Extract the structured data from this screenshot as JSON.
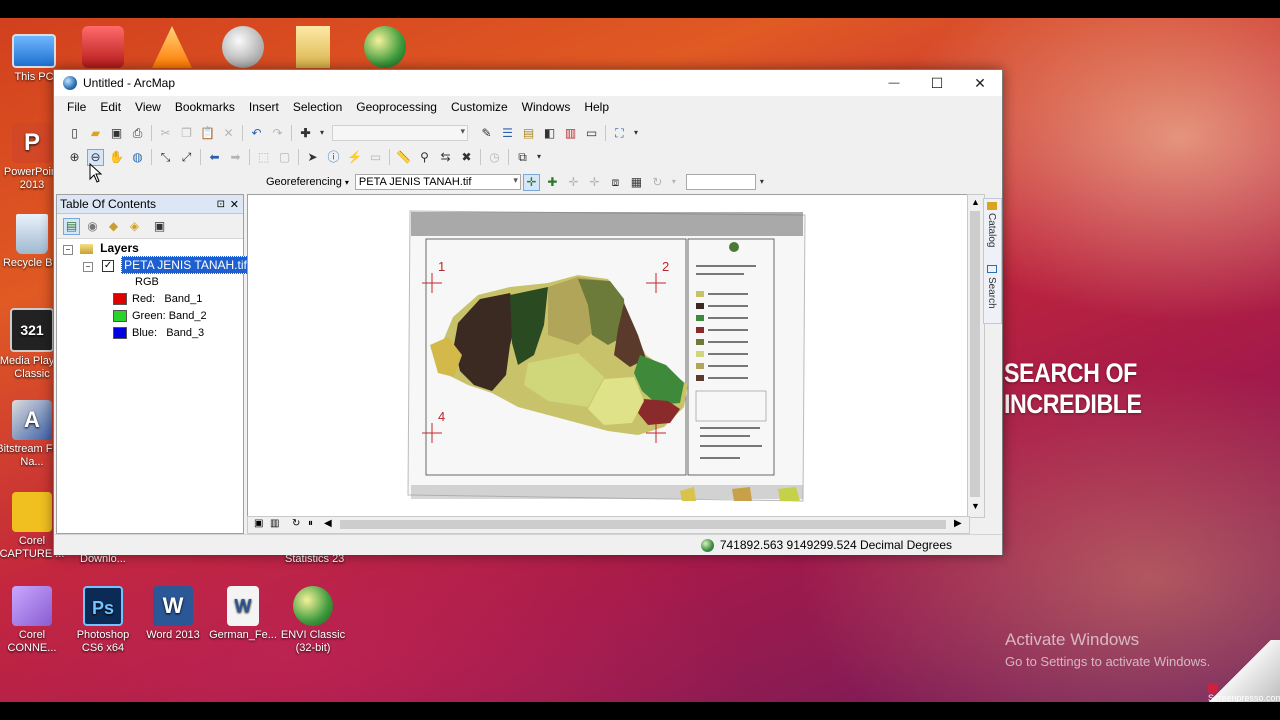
{
  "desktop": {
    "icons": [
      {
        "label": "This PC",
        "color": "#3b8ee0"
      },
      {
        "label": "PowerPoint 2013",
        "color": "#d24726"
      },
      {
        "label": "Recycle Bin",
        "color": "#9fb8d0"
      },
      {
        "label": "Media Player Classic",
        "color": "#222222"
      },
      {
        "label": "Bitstream Font Na...",
        "color": "#3a5fa8"
      },
      {
        "label": "Corel CAPTURE ...",
        "color": "#f0c020"
      },
      {
        "label": "Corel CONNE...",
        "color": "#8a5bd0"
      },
      {
        "label": "Photoshop CS6 x64",
        "color": "#1f4fa0"
      },
      {
        "label": "Word 2013",
        "color": "#2b5797"
      },
      {
        "label": "German_Fe...",
        "color": "#e8e8e8"
      },
      {
        "label": "ENVI Classic (32-bit)",
        "color": "#3c9a3c"
      },
      {
        "label": "Downlo...",
        "color": ""
      },
      {
        "label": "Statistics 23",
        "color": ""
      }
    ],
    "overlay_text": "SEARCH OF INCREDIBLE",
    "activate_title": "Activate Windows",
    "activate_sub": "Go to Settings to activate Windows.",
    "watermark": "Screenpresso",
    "watermark_sub": ".com"
  },
  "window": {
    "title": "Untitled - ArcMap",
    "minimize": "—",
    "maximize": "☐",
    "close": "✕"
  },
  "menu": [
    "File",
    "Edit",
    "View",
    "Bookmarks",
    "Insert",
    "Selection",
    "Geoprocessing",
    "Customize",
    "Windows",
    "Help"
  ],
  "georef": {
    "label": "Georeferencing",
    "layer": "PETA JENIS TANAH.tif"
  },
  "toc": {
    "title": "Table Of Contents",
    "pin": "⊡",
    "close": "✕",
    "root": "Layers",
    "layer": "PETA JENIS TANAH.tif",
    "rgb": "RGB",
    "bands": [
      {
        "channel": "Red:",
        "band": "Band_1",
        "color": "#e00000"
      },
      {
        "channel": "Green:",
        "band": "Band_2",
        "color": "#28d428"
      },
      {
        "channel": "Blue:",
        "band": "Band_3",
        "color": "#0000e0"
      }
    ]
  },
  "map": {
    "control_points": [
      "1",
      "2",
      "4"
    ]
  },
  "sidetabs": [
    "Catalog",
    "Search"
  ],
  "status": {
    "coords": "741892.563  9149299.524 Decimal Degrees"
  }
}
